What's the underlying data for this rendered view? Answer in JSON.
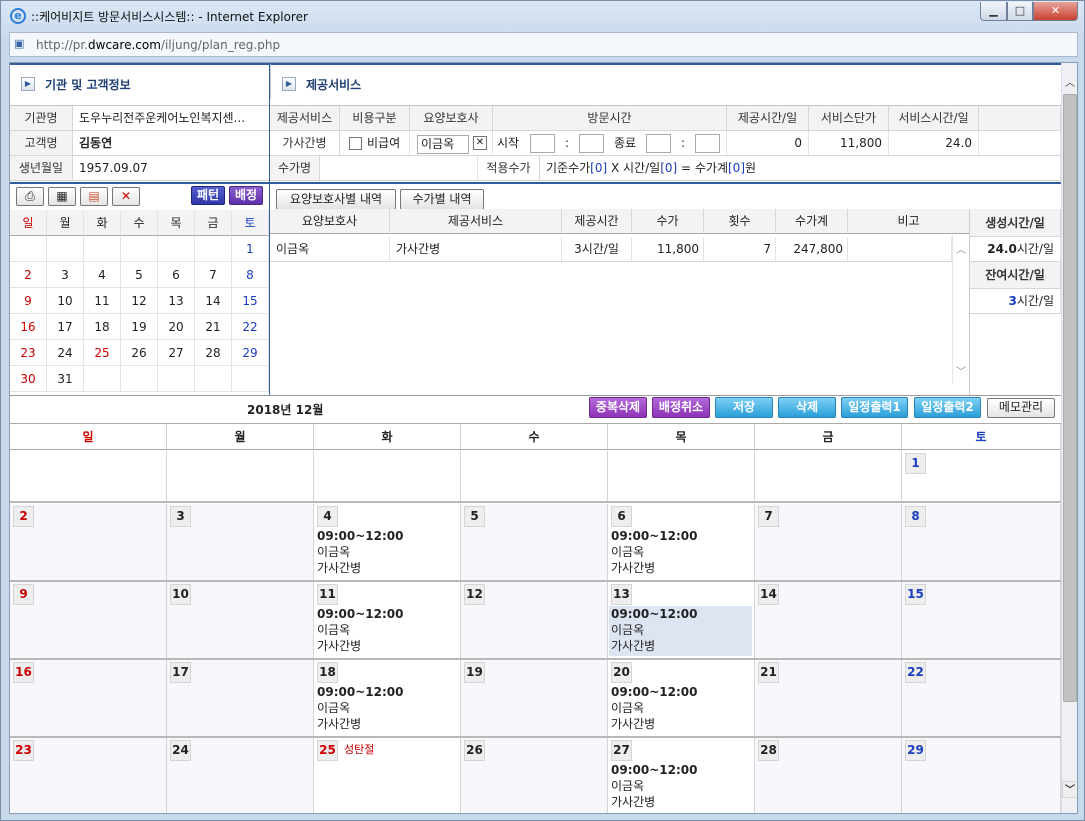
{
  "window": {
    "title": "::케어비지트 방문서비스시스템:: - Internet Explorer",
    "url_prefix": "http://pr.",
    "url_domain": "dwcare.com",
    "url_path": "/iljung/plan_reg.php"
  },
  "sections": {
    "client_info": "기관 및 고객정보",
    "service": "제공서비스"
  },
  "client": {
    "org_label": "기관명",
    "org_value": "도우누리전주운케어노인복지센...",
    "client_label": "고객명",
    "client_value": "김동연",
    "birth_label": "생년월일",
    "birth_value": "1957.09.07"
  },
  "service_headers": [
    "제공서비스",
    "비용구분",
    "요양보호사",
    "방문시간",
    "제공시간/일",
    "서비스단가",
    "서비스시간/일"
  ],
  "service_row": {
    "service": "가사간병",
    "nonpay_label": "비급여",
    "caregiver": "이금옥",
    "start_label": "시작",
    "end_label": "종료",
    "colon": ":",
    "provide_time": "0",
    "unit_price": "11,800",
    "svc_time": "24.0"
  },
  "fee": {
    "label": "수가명",
    "apply_label": "적용수가",
    "formula_a": "기준수가",
    "formula_b": "[0]",
    "formula_c": " X 시간/일",
    "formula_d": "[0]",
    "formula_e": " = 수가계",
    "formula_f": "[0]",
    "formula_g": "원"
  },
  "mini_toolbar": {
    "pattern": "패턴",
    "assign": "배정"
  },
  "mini_cal": {
    "weekdays": [
      "일",
      "월",
      "화",
      "수",
      "목",
      "금",
      "토"
    ],
    "rows": [
      [
        "",
        "",
        "",
        "",
        "",
        "",
        "1"
      ],
      [
        "2",
        "3",
        "4",
        "5",
        "6",
        "7",
        "8"
      ],
      [
        "9",
        "10",
        "11",
        "12",
        "13",
        "14",
        "15"
      ],
      [
        "16",
        "17",
        "18",
        "19",
        "20",
        "21",
        "22"
      ],
      [
        "23",
        "24",
        "25",
        "26",
        "27",
        "28",
        "29"
      ],
      [
        "30",
        "31",
        "",
        "",
        "",
        "",
        ""
      ]
    ]
  },
  "tabs": {
    "by_caregiver": "요양보호사별 내역",
    "by_fee": "수가별 내역"
  },
  "detail_headers": [
    "요양보호사",
    "제공서비스",
    "제공시간",
    "수가",
    "횟수",
    "수가계",
    "비고"
  ],
  "detail_rows": [
    [
      "이금옥",
      "가사간병",
      "3시간/일",
      "11,800",
      "7",
      "247,800",
      ""
    ]
  ],
  "side": {
    "gen_label": "생성시간/일",
    "gen_value": "24.0",
    "gen_unit": "시간/일",
    "remain_label": "잔여시간/일",
    "remain_value": "3",
    "remain_unit": "시간/일"
  },
  "month_title": "2018년 12월",
  "actions": {
    "dup_delete": "중복삭제",
    "assign_cancel": "배정취소",
    "save": "저장",
    "delete": "삭제",
    "print1": "일정출력1",
    "print2": "일정출력2",
    "memo": "메모관리"
  },
  "big_cal": {
    "weekdays": [
      "일",
      "월",
      "화",
      "수",
      "목",
      "금",
      "토"
    ],
    "weeks": [
      [
        {
          "d": ""
        },
        {
          "d": ""
        },
        {
          "d": ""
        },
        {
          "d": ""
        },
        {
          "d": ""
        },
        {
          "d": ""
        },
        {
          "d": "1"
        }
      ],
      [
        {
          "d": "2"
        },
        {
          "d": "3"
        },
        {
          "d": "4",
          "time": "09:00~12:00",
          "cg": "이금옥",
          "svc": "가사간병"
        },
        {
          "d": "5"
        },
        {
          "d": "6",
          "time": "09:00~12:00",
          "cg": "이금옥",
          "svc": "가사간병"
        },
        {
          "d": "7"
        },
        {
          "d": "8"
        }
      ],
      [
        {
          "d": "9"
        },
        {
          "d": "10"
        },
        {
          "d": "11",
          "time": "09:00~12:00",
          "cg": "이금옥",
          "svc": "가사간병"
        },
        {
          "d": "12"
        },
        {
          "d": "13",
          "time": "09:00~12:00",
          "cg": "이금옥",
          "svc": "가사간병",
          "hl": true
        },
        {
          "d": "14"
        },
        {
          "d": "15"
        }
      ],
      [
        {
          "d": "16"
        },
        {
          "d": "17"
        },
        {
          "d": "18",
          "time": "09:00~12:00",
          "cg": "이금옥",
          "svc": "가사간병"
        },
        {
          "d": "19"
        },
        {
          "d": "20",
          "time": "09:00~12:00",
          "cg": "이금옥",
          "svc": "가사간병"
        },
        {
          "d": "21"
        },
        {
          "d": "22"
        }
      ],
      [
        {
          "d": "23"
        },
        {
          "d": "24"
        },
        {
          "d": "25",
          "holiday": "성탄절"
        },
        {
          "d": "26"
        },
        {
          "d": "27",
          "time": "09:00~12:00",
          "cg": "이금옥",
          "svc": "가사간병"
        },
        {
          "d": "28"
        },
        {
          "d": "29"
        }
      ]
    ]
  },
  "colors": {
    "header_blue": "#2f5e9a",
    "sunday": "#cc0000",
    "saturday": "#1a3fbf",
    "highlight": "#dde4f2"
  }
}
